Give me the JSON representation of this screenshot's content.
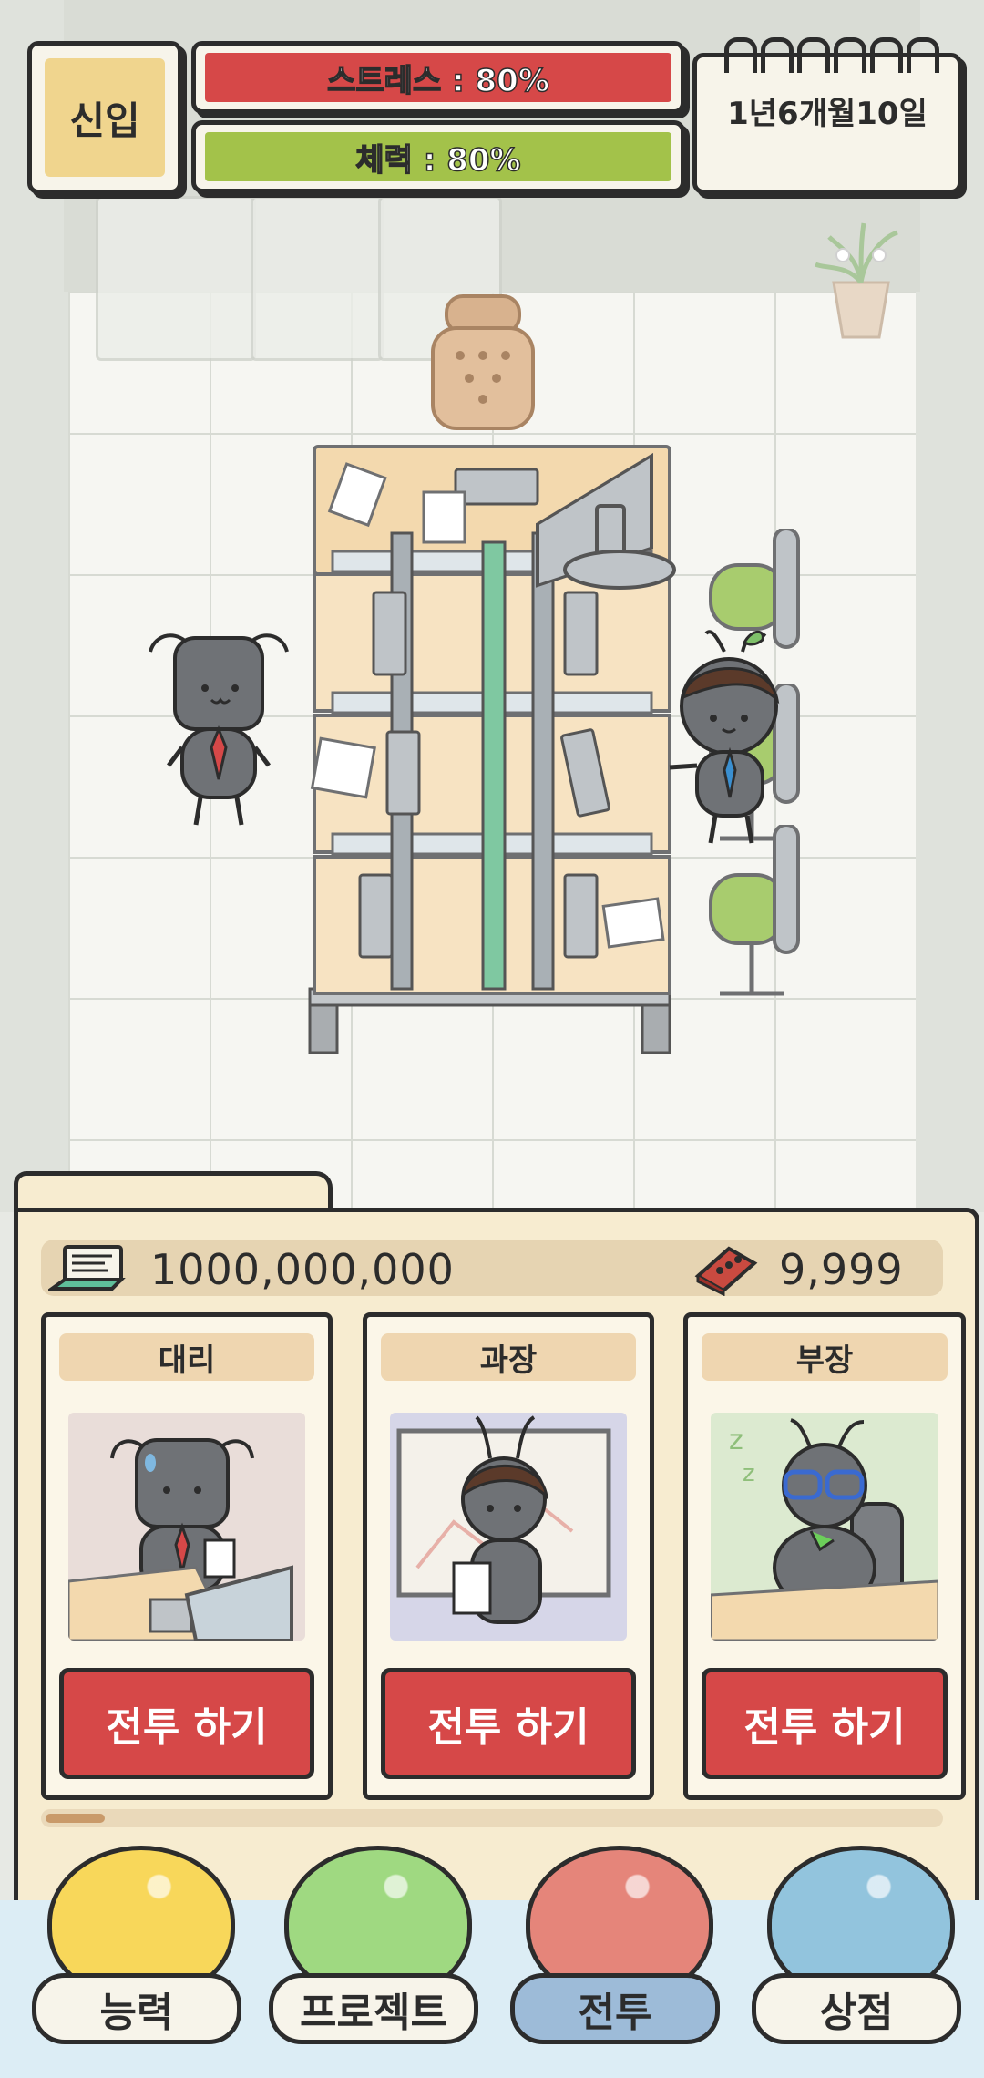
{
  "hud": {
    "rank": "신입",
    "stress": {
      "label": "스트레스 : 80%",
      "value": 0.8,
      "color": "#d64848"
    },
    "stamina": {
      "label": "체력 : 80%",
      "value": 0.8,
      "color": "#a3c24a"
    },
    "date": "1년6개월10일"
  },
  "currency": {
    "money": "1000,000,000",
    "money_icon": "laptop-icon",
    "bricks": "9,999",
    "bricks_icon": "brick-icon"
  },
  "cards": [
    {
      "title": "대리",
      "button": "전투 하기",
      "art": "nervous-ant-portrait"
    },
    {
      "title": "과장",
      "button": "전투 하기",
      "art": "thinking-ant-portrait"
    },
    {
      "title": "부장",
      "button": "전투 하기",
      "art": "sleeping-ant-portrait"
    }
  ],
  "nav": [
    {
      "label": "능력",
      "color": "#f8d75a",
      "active": false
    },
    {
      "label": "프로젝트",
      "color": "#9fd981",
      "active": false
    },
    {
      "label": "전투",
      "color": "#e5857a",
      "active": true
    },
    {
      "label": "상점",
      "color": "#92c4dd",
      "active": false
    }
  ],
  "colors": {
    "outline": "#2c2c2c",
    "panel": "#f7ecd0",
    "button_red": "#d64848"
  }
}
